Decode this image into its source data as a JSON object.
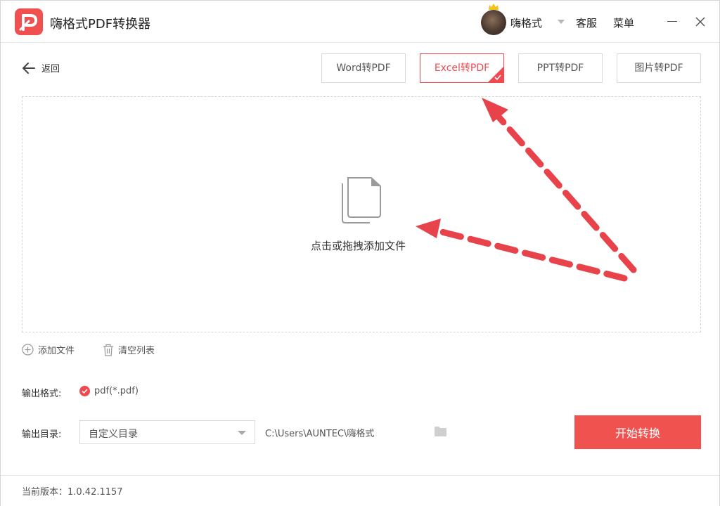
{
  "app": {
    "title": "嗨格式PDF转换器"
  },
  "header": {
    "username": "嗨格式",
    "service_label": "客服",
    "menu_label": "菜单"
  },
  "toolbar": {
    "back_label": "返回"
  },
  "tabs": [
    {
      "label": "Word转PDF",
      "active": false
    },
    {
      "label": "Excel转PDF",
      "active": true
    },
    {
      "label": "PPT转PDF",
      "active": false
    },
    {
      "label": "图片转PDF",
      "active": false
    }
  ],
  "dropzone": {
    "label": "点击或拖拽添加文件"
  },
  "file_actions": {
    "add_label": "添加文件",
    "clear_label": "清空列表"
  },
  "output": {
    "format_label": "输出格式:",
    "format_value": "pdf(*.pdf)",
    "dir_label": "输出目录:",
    "dir_select": "自定义目录",
    "dir_path": "C:\\Users\\AUNTEC\\嗨格式"
  },
  "actions": {
    "start_label": "开始转换"
  },
  "footer": {
    "version": "当前版本：1.0.42.1157"
  },
  "colors": {
    "accent": "#ef4a4f",
    "arrow": "#e8424b"
  }
}
